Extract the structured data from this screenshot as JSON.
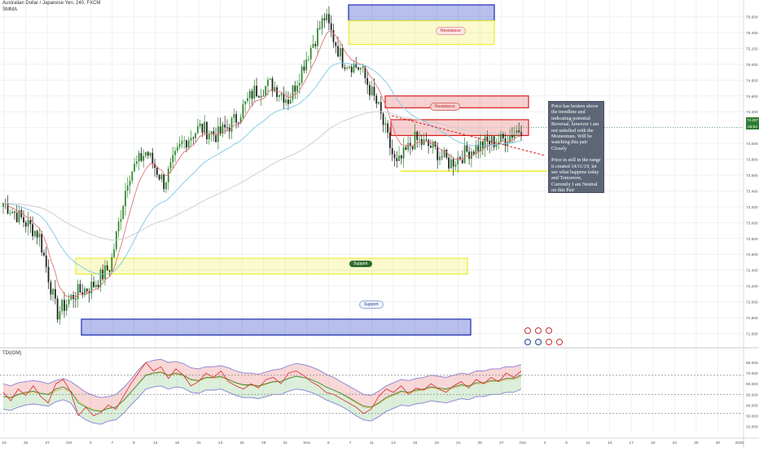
{
  "header": {
    "symbol_title": "Australian Dollar / Japanese Yen, 240, FXCM",
    "indicator_label": "SMMA"
  },
  "sub_header": {
    "indicator_label": "TDI(OM)"
  },
  "price_badge": {
    "price": "74.207",
    "countdown": "03:54"
  },
  "annotations": {
    "note_p1": "Price has broken above the trendline and indicating potential Reversal, however i am not satisfied with the Momentum. Will be watching this pair Closely",
    "note_p2": "Price in still in the range it created 14/11/19, let see what happens today and Tomorrow, Currently I am Neutral on this Pair",
    "resistance_top": "Resistance",
    "resistance_mid": "Resistance",
    "support_top": "Support",
    "support_bottom": "Support"
  },
  "colors": {
    "bull": "#2e8b2e",
    "bear": "#222222",
    "ma_fast": "#e07575",
    "ma_mid": "#7ec8e3",
    "ma_slow": "#cfcfcf",
    "res_red": "#d62020",
    "sup_blue": "#1c2bb0",
    "zone_yellow": "#eded3a",
    "rsi_line": "#e03a3a",
    "rsi_signal": "#2f8f2f",
    "band_line": "#8a7fd6"
  },
  "chart_data": [
    {
      "type": "candlestick",
      "title": "Australian Dollar / Japanese Yen, 240, FXCM",
      "y_axis_side": "right",
      "ylim": [
        71.45,
        75.75
      ],
      "y_ticks": [
        "75.600",
        "75.400",
        "75.200",
        "75.000",
        "74.800",
        "74.600",
        "74.400",
        "74.200",
        "74.000",
        "73.800",
        "73.600",
        "73.400",
        "73.200",
        "73.000",
        "72.800",
        "72.600",
        "72.400",
        "72.200",
        "72.000",
        "71.800",
        "71.600"
      ],
      "x_ticks": [
        "23",
        "25",
        "27",
        "Oct",
        "3",
        "7",
        "9",
        "14",
        "16",
        "21",
        "23",
        "25",
        "29",
        "31",
        "Nov",
        "5",
        "7",
        "11",
        "13",
        "15",
        "19",
        "21",
        "25",
        "27",
        "Dec",
        "4",
        "6",
        "11",
        "13",
        "17",
        "19",
        "23",
        "25",
        "30",
        "2020"
      ],
      "anchor_closes": [
        {
          "date": "23 Sep",
          "close": 73.25
        },
        {
          "date": "27 Sep",
          "close": 73.05
        },
        {
          "date": "Oct",
          "close": 72.85
        },
        {
          "date": "2 Oct",
          "close": 71.85
        },
        {
          "date": "3 Oct",
          "close": 72.1
        },
        {
          "date": "7 Oct",
          "close": 72.2
        },
        {
          "date": "9 Oct",
          "close": 72.45
        },
        {
          "date": "11 Oct",
          "close": 73.6
        },
        {
          "date": "14 Oct",
          "close": 73.9
        },
        {
          "date": "16 Oct",
          "close": 73.5
        },
        {
          "date": "18 Oct",
          "close": 74.0
        },
        {
          "date": "21 Oct",
          "close": 74.2
        },
        {
          "date": "23 Oct",
          "close": 74.1
        },
        {
          "date": "25 Oct",
          "close": 74.3
        },
        {
          "date": "29 Oct",
          "close": 74.65
        },
        {
          "date": "31 Oct",
          "close": 74.75
        },
        {
          "date": "Nov",
          "close": 74.55
        },
        {
          "date": "5 Nov",
          "close": 75.1
        },
        {
          "date": "7 Nov",
          "close": 75.6
        },
        {
          "date": "8 Nov",
          "close": 75.05
        },
        {
          "date": "11 Nov",
          "close": 74.95
        },
        {
          "date": "13 Nov",
          "close": 74.45
        },
        {
          "date": "14 Nov",
          "close": 73.7
        },
        {
          "date": "15 Nov",
          "close": 74.05
        },
        {
          "date": "19 Nov",
          "close": 73.95
        },
        {
          "date": "21 Nov",
          "close": 73.75
        },
        {
          "date": "25 Nov",
          "close": 73.9
        },
        {
          "date": "27 Nov",
          "close": 74.0
        },
        {
          "date": "29 Nov",
          "close": 74.05
        },
        {
          "date": "2 Dec",
          "close": 74.2
        }
      ],
      "zones": [
        {
          "label": "Resistance",
          "color": "blue",
          "from": 75.55,
          "to": 75.75
        },
        {
          "label": "",
          "color": "yellow",
          "from": 75.25,
          "to": 75.55
        },
        {
          "label": "Resistance",
          "color": "red",
          "from": 74.45,
          "to": 74.6
        },
        {
          "label": "",
          "color": "red",
          "from": 74.1,
          "to": 74.3
        },
        {
          "label": "Support",
          "color": "yellow",
          "from": 72.35,
          "to": 72.55
        },
        {
          "label": "Support",
          "color": "blue",
          "from": 71.58,
          "to": 71.78
        }
      ],
      "levels": [
        {
          "color": "yellow",
          "value": 73.65
        }
      ],
      "trendline": {
        "from": {
          "date": "14 Nov",
          "value": 74.35
        },
        "to": {
          "date": "4 Dec",
          "value": 73.85
        }
      },
      "grid": true
    },
    {
      "type": "line",
      "title": "TDI(OM)",
      "ylim": [
        15,
        90
      ],
      "y_ticks": [
        "80.000",
        "70.000",
        "60.000",
        "50.000",
        "40.000",
        "30.000",
        "20.000"
      ],
      "reference_lines": [
        68,
        50,
        32
      ],
      "series": [
        {
          "color": "red",
          "values": [
            52,
            44,
            55,
            49,
            58,
            48,
            42,
            60,
            64,
            52,
            30,
            38,
            30,
            33,
            40,
            36,
            48,
            60,
            70,
            80,
            72,
            76,
            65,
            74,
            68,
            58,
            62,
            70,
            66,
            72,
            62,
            58,
            55,
            60,
            56,
            64,
            66,
            60,
            70,
            72,
            68,
            62,
            58,
            52,
            50,
            46,
            42,
            38,
            32,
            36,
            48,
            55,
            52,
            58,
            50,
            56,
            54,
            60,
            55,
            52,
            58,
            62,
            56,
            64,
            60,
            66,
            62,
            70,
            66,
            72
          ]
        },
        {
          "color": "green",
          "values": [
            48,
            47,
            50,
            52,
            53,
            51,
            50,
            55,
            57,
            53,
            42,
            38,
            35,
            34,
            37,
            38,
            44,
            52,
            60,
            68,
            70,
            71,
            68,
            70,
            68,
            64,
            63,
            66,
            66,
            67,
            64,
            61,
            59,
            59,
            58,
            60,
            62,
            62,
            65,
            67,
            66,
            64,
            61,
            57,
            54,
            51,
            47,
            43,
            39,
            38,
            42,
            47,
            50,
            53,
            52,
            54,
            55,
            57,
            56,
            55,
            57,
            59,
            58,
            61,
            61,
            63,
            63,
            65,
            65,
            68
          ]
        },
        {
          "color": "band",
          "values": [
            60,
            58,
            61,
            62,
            63,
            62,
            60,
            63,
            65,
            62,
            57,
            52,
            49,
            47,
            48,
            50,
            56,
            64,
            73,
            80,
            82,
            83,
            80,
            81,
            79,
            75,
            74,
            76,
            76,
            77,
            75,
            72,
            70,
            70,
            69,
            71,
            73,
            74,
            77,
            79,
            78,
            76,
            73,
            69,
            66,
            62,
            58,
            54,
            50,
            49,
            53,
            58,
            61,
            64,
            63,
            65,
            66,
            68,
            67,
            66,
            68,
            70,
            69,
            72,
            72,
            74,
            74,
            76,
            76,
            78
          ]
        },
        {
          "color": "band",
          "values": [
            36,
            35,
            38,
            40,
            41,
            40,
            39,
            43,
            45,
            42,
            31,
            26,
            23,
            22,
            25,
            26,
            32,
            40,
            47,
            55,
            57,
            58,
            55,
            57,
            56,
            52,
            51,
            54,
            54,
            55,
            52,
            49,
            47,
            47,
            46,
            48,
            50,
            50,
            53,
            55,
            54,
            52,
            49,
            45,
            42,
            39,
            35,
            30,
            26,
            25,
            29,
            34,
            37,
            40,
            39,
            41,
            42,
            44,
            43,
            42,
            44,
            46,
            45,
            48,
            48,
            50,
            50,
            52,
            52,
            55
          ]
        }
      ],
      "grid": true
    }
  ]
}
